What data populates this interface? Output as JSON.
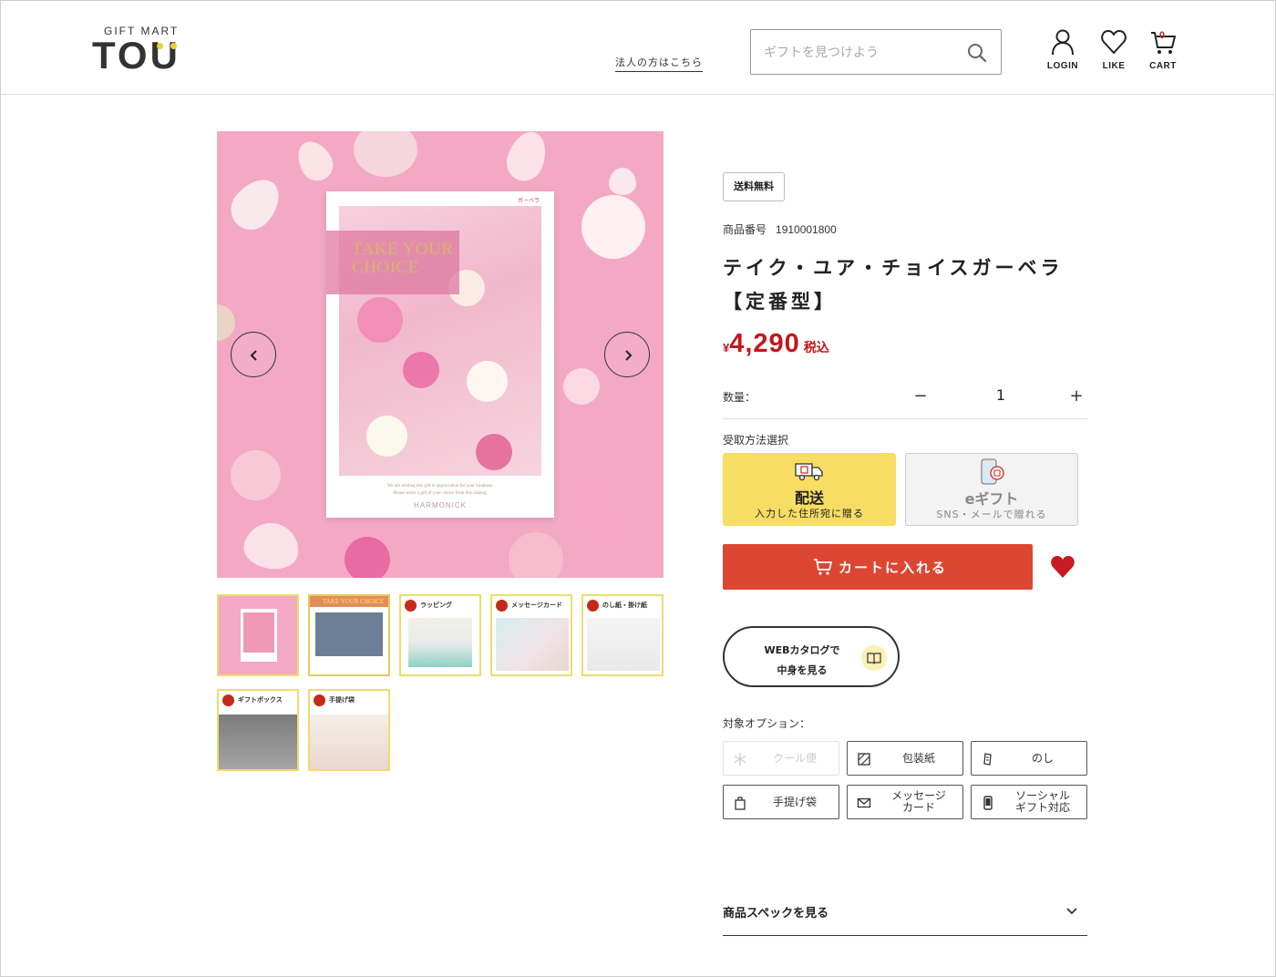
{
  "header": {
    "logo_sub": "GIFT MART",
    "logo_main": "TOU",
    "corporate_link": "法人の方はこちら",
    "search_placeholder": "ギフトを見つけよう",
    "login_label": "LOGIN",
    "like_label": "LIKE",
    "cart_label": "CART",
    "cart_count": "0"
  },
  "gallery": {
    "catalog_title_line1": "TAKE YOUR",
    "catalog_title_line2": "CHOICE",
    "catalog_tag": "ガーベラ",
    "catalog_foot1": "We are sending this gift in appreciation for your kindness.",
    "catalog_foot2": "Please select a gift of your choice from this catalog.",
    "catalog_brand": "HARMONICK",
    "thumbnails": [
      {
        "title": ""
      },
      {
        "title": "TAKE YOUR CHOICE"
      },
      {
        "title": "ラッピング"
      },
      {
        "title": "メッセージカード"
      },
      {
        "title": "のし紙・掛け紙"
      },
      {
        "title": "ギフトボックス"
      },
      {
        "title": "手提げ袋"
      }
    ]
  },
  "product": {
    "badge": "送料無料",
    "id_label": "商品番号",
    "id_value": "1910001800",
    "title_line1": "テイク・ユア・チョイスガーベラ",
    "title_line2": "【定番型】",
    "price_yen": "¥",
    "price_amount": "4,290",
    "price_tax": "税込",
    "qty_label": "数量：",
    "qty_value": "1",
    "qty_minus": "−",
    "qty_plus": "+",
    "receive_label": "受取方法選択",
    "delivery_title": "配送",
    "delivery_sub": "入力した住所宛に贈る",
    "egift_title": "eギフト",
    "egift_sub": "SNS・メールで贈れる",
    "add_to_cart": "カートに入れる",
    "web_catalog_line1": "WEBカタログで",
    "web_catalog_line2": "中身を見る",
    "options_label": "対象オプション：",
    "options": [
      {
        "label": "クール便",
        "enabled": false
      },
      {
        "label": "包装紙",
        "enabled": true
      },
      {
        "label": "のし",
        "enabled": true
      },
      {
        "label": "手提げ袋",
        "enabled": true
      },
      {
        "label": "メッセージ\nカード",
        "enabled": true
      },
      {
        "label": "ソーシャル\nギフト対応",
        "enabled": true
      }
    ],
    "spec_label": "商品スペックを見る"
  },
  "colors": {
    "accent_red": "#dd4632",
    "price_red": "#c4161c",
    "delivery_yellow": "#f7dd64",
    "logo_yellow": "#f0cf35"
  }
}
